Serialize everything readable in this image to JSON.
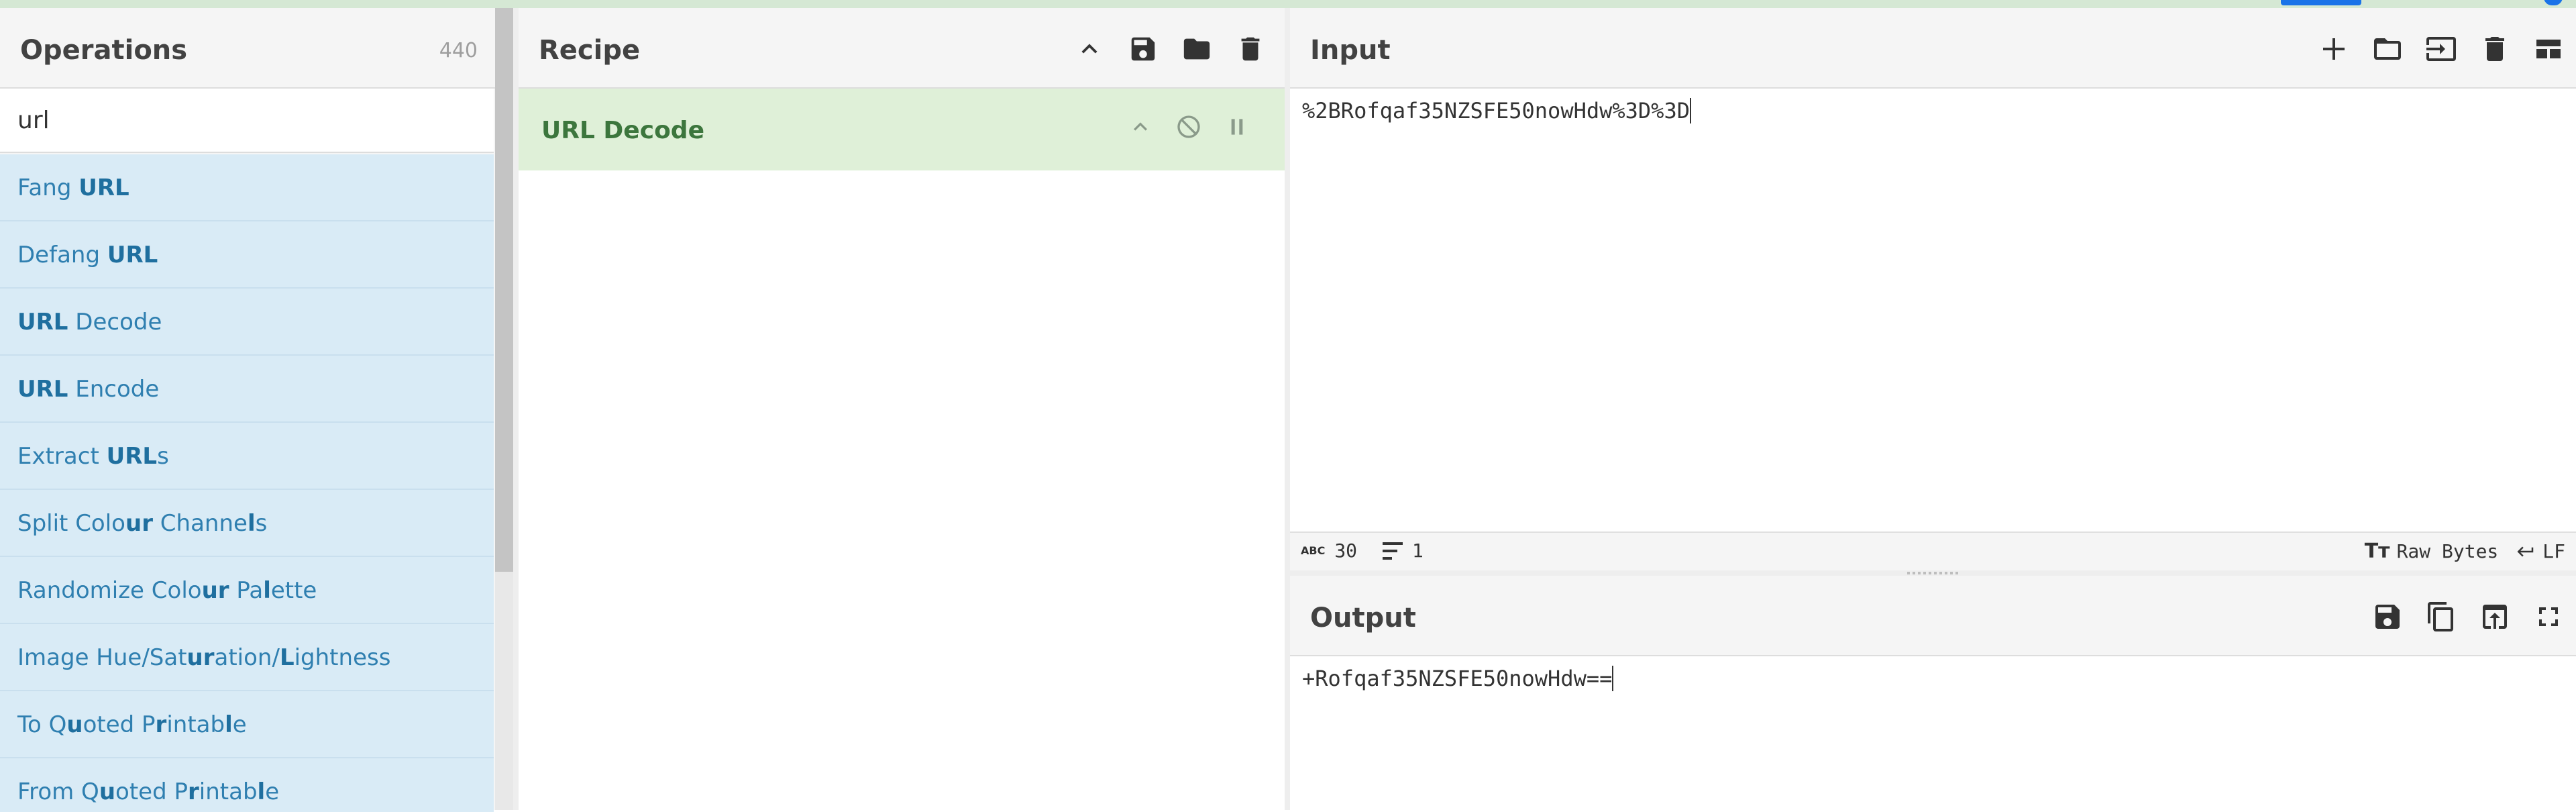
{
  "operations": {
    "title": "Operations",
    "count": "440",
    "search_value": "url",
    "items": [
      {
        "parts": [
          {
            "t": "Fang ",
            "b": false
          },
          {
            "t": "URL",
            "b": true
          }
        ]
      },
      {
        "parts": [
          {
            "t": "Defang ",
            "b": false
          },
          {
            "t": "URL",
            "b": true
          }
        ]
      },
      {
        "parts": [
          {
            "t": "URL",
            "b": true
          },
          {
            "t": " Decode",
            "b": false
          }
        ]
      },
      {
        "parts": [
          {
            "t": "URL",
            "b": true
          },
          {
            "t": " Encode",
            "b": false
          }
        ]
      },
      {
        "parts": [
          {
            "t": "Extract ",
            "b": false
          },
          {
            "t": "URL",
            "b": true
          },
          {
            "t": "s",
            "b": false
          }
        ]
      },
      {
        "parts": [
          {
            "t": "Split Colo",
            "b": false
          },
          {
            "t": "ur",
            "b": true
          },
          {
            "t": " Channe",
            "b": false
          },
          {
            "t": "l",
            "b": true
          },
          {
            "t": "s",
            "b": false
          }
        ]
      },
      {
        "parts": [
          {
            "t": "Randomize Colo",
            "b": false
          },
          {
            "t": "ur",
            "b": true
          },
          {
            "t": " Pa",
            "b": false
          },
          {
            "t": "l",
            "b": true
          },
          {
            "t": "ette",
            "b": false
          }
        ]
      },
      {
        "parts": [
          {
            "t": "Image Hue/Sat",
            "b": false
          },
          {
            "t": "ur",
            "b": true
          },
          {
            "t": "ation/",
            "b": false
          },
          {
            "t": "L",
            "b": true
          },
          {
            "t": "ightness",
            "b": false
          }
        ]
      },
      {
        "parts": [
          {
            "t": "To Q",
            "b": false
          },
          {
            "t": "u",
            "b": true
          },
          {
            "t": "oted P",
            "b": false
          },
          {
            "t": "r",
            "b": true
          },
          {
            "t": "inta",
            "b": false
          },
          {
            "t": "b",
            "b": false
          },
          {
            "t": "l",
            "b": true
          },
          {
            "t": "e",
            "b": false
          }
        ]
      },
      {
        "parts": [
          {
            "t": "From Q",
            "b": false
          },
          {
            "t": "u",
            "b": true
          },
          {
            "t": "oted P",
            "b": false
          },
          {
            "t": "r",
            "b": true
          },
          {
            "t": "inta",
            "b": false
          },
          {
            "t": "b",
            "b": false
          },
          {
            "t": "l",
            "b": true
          },
          {
            "t": "e",
            "b": false
          }
        ]
      }
    ]
  },
  "recipe": {
    "title": "Recipe",
    "ops": [
      {
        "name": "URL Decode"
      }
    ]
  },
  "input": {
    "title": "Input",
    "text": "%2BRofqaf35NZSFE50nowHdw%3D%3D",
    "status": {
      "chars_label": "ABC",
      "chars": "30",
      "lines": "1",
      "encoding": "Raw Bytes",
      "eol": "LF"
    }
  },
  "output": {
    "title": "Output",
    "text": "+Rofqaf35NZSFE50nowHdw=="
  },
  "colors": {
    "op_item_bg": "#d9ebf6",
    "op_item_text": "#2f7fb0",
    "recipe_op_bg": "#dff0d8",
    "recipe_op_text": "#3c763d"
  }
}
